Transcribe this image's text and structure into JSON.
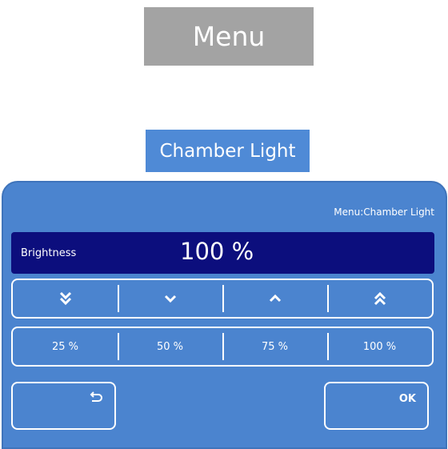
{
  "menu_button": {
    "label": "Menu"
  },
  "chamber_light_button": {
    "label": "Chamber Light"
  },
  "panel": {
    "caption": "Menu:Chamber Light",
    "brightness": {
      "label": "Brightness",
      "value": "100 %"
    },
    "step_buttons": [
      {
        "icon": "double-chevron-down-icon"
      },
      {
        "icon": "chevron-down-icon"
      },
      {
        "icon": "chevron-up-icon"
      },
      {
        "icon": "double-chevron-up-icon"
      }
    ],
    "preset_buttons": [
      {
        "label": "25 %"
      },
      {
        "label": "50 %"
      },
      {
        "label": "75 %"
      },
      {
        "label": "100 %"
      }
    ],
    "back_button": {
      "icon": "return-arrow-icon"
    },
    "ok_button": {
      "label": "OK"
    }
  },
  "colors": {
    "menu_gray": "#a3a3a3",
    "accent_blue": "#4f8ad6",
    "panel_blue": "#4b84cf",
    "value_bar_navy": "#0c0e7d"
  }
}
